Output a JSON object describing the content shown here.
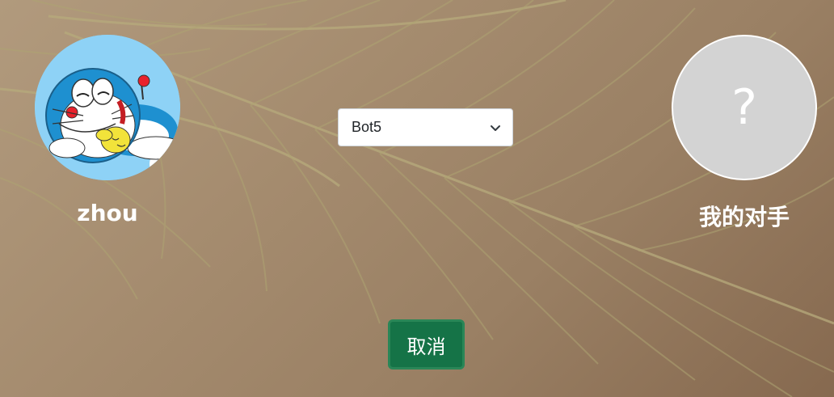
{
  "player_self": {
    "name": "zhou",
    "avatar_icon": "doraemon-avatar"
  },
  "player_opponent": {
    "name": "我的对手",
    "placeholder_glyph": "?"
  },
  "bot_select": {
    "selected": "Bot5"
  },
  "cancel_button": {
    "label": "取消",
    "color": "#157347"
  }
}
